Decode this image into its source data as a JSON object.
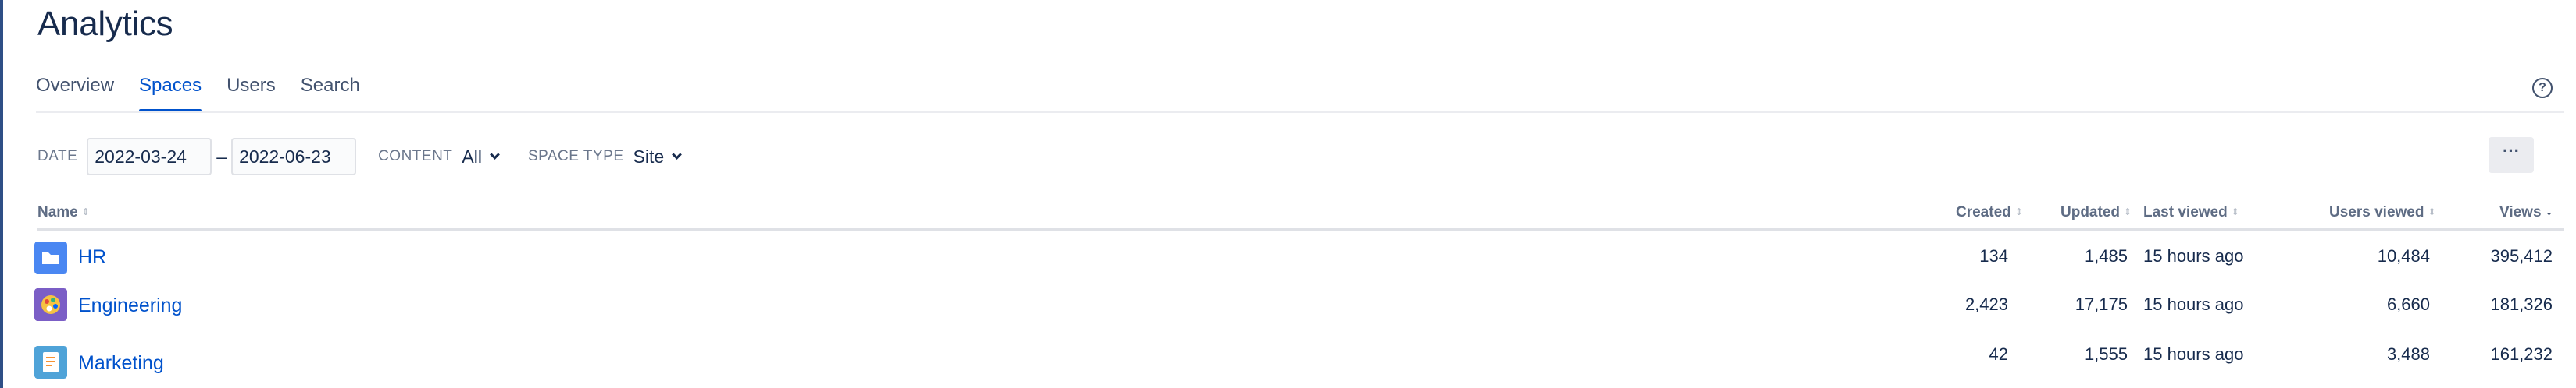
{
  "page": {
    "title": "Analytics"
  },
  "tabs": [
    {
      "label": "Overview",
      "active": false
    },
    {
      "label": "Spaces",
      "active": true
    },
    {
      "label": "Users",
      "active": false
    },
    {
      "label": "Search",
      "active": false
    }
  ],
  "help": {
    "icon": "question-circle-icon",
    "glyph": "?"
  },
  "filters": {
    "date_label": "DATE",
    "date_from": "2022-03-24",
    "date_separator": "–",
    "date_to": "2022-06-23",
    "content_label": "CONTENT",
    "content_value": "All",
    "space_type_label": "SPACE TYPE",
    "space_type_value": "Site"
  },
  "more_button": {
    "label": "···",
    "icon": "more-icon"
  },
  "table": {
    "columns": [
      "Name",
      "Created",
      "Updated",
      "Last viewed",
      "Users viewed",
      "Views"
    ],
    "sort_glyph": "⇕",
    "sort_active_glyph": "⌄",
    "sorted_column": "Views",
    "rows": [
      {
        "name": "HR",
        "icon": "folder-icon",
        "created": "134",
        "updated": "1,485",
        "last_viewed": "15 hours ago",
        "users_viewed": "10,484",
        "views": "395,412"
      },
      {
        "name": "Engineering",
        "icon": "paint-palette-icon",
        "created": "2,423",
        "updated": "17,175",
        "last_viewed": "15 hours ago",
        "users_viewed": "6,660",
        "views": "181,326"
      },
      {
        "name": "Marketing",
        "icon": "notebook-icon",
        "created": "42",
        "updated": "1,555",
        "last_viewed": "15 hours ago",
        "users_viewed": "3,488",
        "views": "161,232"
      }
    ]
  },
  "colors": {
    "accent": "#0052cc",
    "text": "#172b4d",
    "muted": "#6b778c",
    "border": "#dfe1e6",
    "folder_blue": "#4a87f2",
    "palette_purple": "#7b5ec6",
    "notebook_blue": "#4fa3d8"
  }
}
